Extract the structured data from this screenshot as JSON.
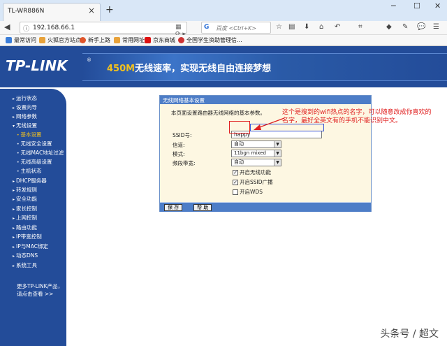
{
  "browser": {
    "tab_title": "TL-WR886N",
    "tab_close": "×",
    "new_tab": "+",
    "url": "192.168.66.1",
    "search_placeholder": "百度 <Ctrl+K>",
    "search_engine_badge": "G"
  },
  "bookmarks": [
    {
      "label": "最常访问",
      "color": "#3b7dd8"
    },
    {
      "label": "火狐官方站点",
      "color": "#e8a23a"
    },
    {
      "label": "新手上路",
      "color": "#e0552a"
    },
    {
      "label": "常用网址",
      "color": "#e8a23a"
    },
    {
      "label": "京东商城",
      "color": "#d11"
    },
    {
      "label": "全国学生资助管理信...",
      "color": "#c33"
    }
  ],
  "banner": {
    "logo": "TP-LINK",
    "slogan_highlight": "450M",
    "slogan_rest": "无线速率，实现无线自由连接梦想"
  },
  "nav": [
    {
      "label": "运行状态",
      "sub": false
    },
    {
      "label": "设置向导",
      "sub": false
    },
    {
      "label": "网络参数",
      "sub": false
    },
    {
      "label": "无线设置",
      "sub": false
    },
    {
      "label": "基本设置",
      "sub": true,
      "active": true
    },
    {
      "label": "无线安全设置",
      "sub": true
    },
    {
      "label": "无线MAC地址过滤",
      "sub": true
    },
    {
      "label": "无线高级设置",
      "sub": true
    },
    {
      "label": "主机状态",
      "sub": true
    },
    {
      "label": "DHCP服务器",
      "sub": false
    },
    {
      "label": "转发规则",
      "sub": false
    },
    {
      "label": "安全功能",
      "sub": false
    },
    {
      "label": "家长控制",
      "sub": false
    },
    {
      "label": "上网控制",
      "sub": false
    },
    {
      "label": "路由功能",
      "sub": false
    },
    {
      "label": "IP带宽控制",
      "sub": false
    },
    {
      "label": "IP与MAC绑定",
      "sub": false
    },
    {
      "label": "动态DNS",
      "sub": false
    },
    {
      "label": "系统工具",
      "sub": false
    }
  ],
  "more": {
    "line1": "更多TP-LINK产品，",
    "line2": "请点击查看 >>"
  },
  "panel": {
    "title": "无线网络基本设置",
    "description": "本页面设置路由器无线网络的基本参数。",
    "ssid_label": "SSID号:",
    "ssid_value": "happy",
    "channel_label": "信道:",
    "channel_value": "自动",
    "mode_label": "模式:",
    "mode_value": "11bgn mixed",
    "bandwidth_label": "频段带宽:",
    "bandwidth_value": "自动",
    "checkboxes": [
      {
        "label": "开启无线功能",
        "checked": true
      },
      {
        "label": "开启SSID广播",
        "checked": true
      },
      {
        "label": "开启WDS",
        "checked": false
      }
    ],
    "save_label": "保 存",
    "help_label": "帮 助"
  },
  "annotation": {
    "line1": "这个是搜到的wifi热点的名字，可以随意改成你喜欢的",
    "line2": "名字，最好全英文有的手机不能识别中文。"
  },
  "watermark": "头条号 / 超文",
  "colors": {
    "brand_blue": "#234c99",
    "panel_blue": "#4d7dc7",
    "annotation_red": "#e02020",
    "nav_active": "#f2c11e"
  }
}
